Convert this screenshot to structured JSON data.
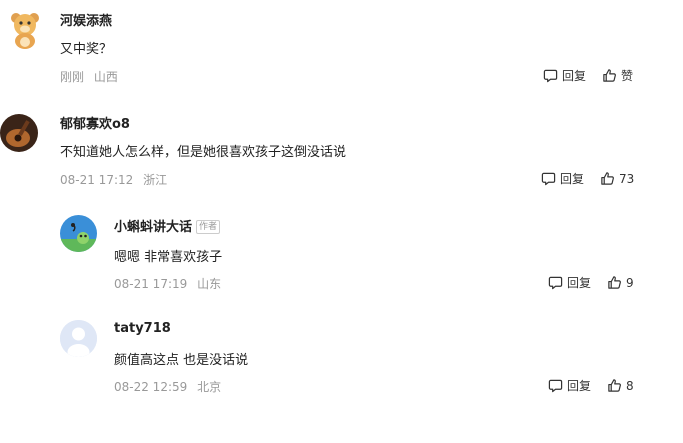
{
  "comments": [
    {
      "username": "河娱添燕",
      "text": "又中奖？",
      "time": "刚刚",
      "location": "山西",
      "reply_label": "回复",
      "like_label": "赞"
    },
    {
      "username": "郁郁寡欢o8",
      "text": "不知道她人怎么样，但是她很喜欢孩子这倒没话说",
      "time": "08-21 17:12",
      "location": "浙江",
      "reply_label": "回复",
      "like_count": "73"
    }
  ],
  "replies": [
    {
      "username": "小蝌蚪讲大话",
      "author_badge": "作者",
      "text": "嗯嗯 非常喜欢孩子",
      "time": "08-21 17:19",
      "location": "山东",
      "reply_label": "回复",
      "like_count": "9"
    },
    {
      "username": "taty718",
      "text": "颜值高这点 也是没话说",
      "time": "08-22 12:59",
      "location": "北京",
      "reply_label": "回复",
      "like_count": "8"
    }
  ],
  "icons": {
    "reply": "comment-bubble-icon",
    "like": "thumbs-up-icon"
  }
}
